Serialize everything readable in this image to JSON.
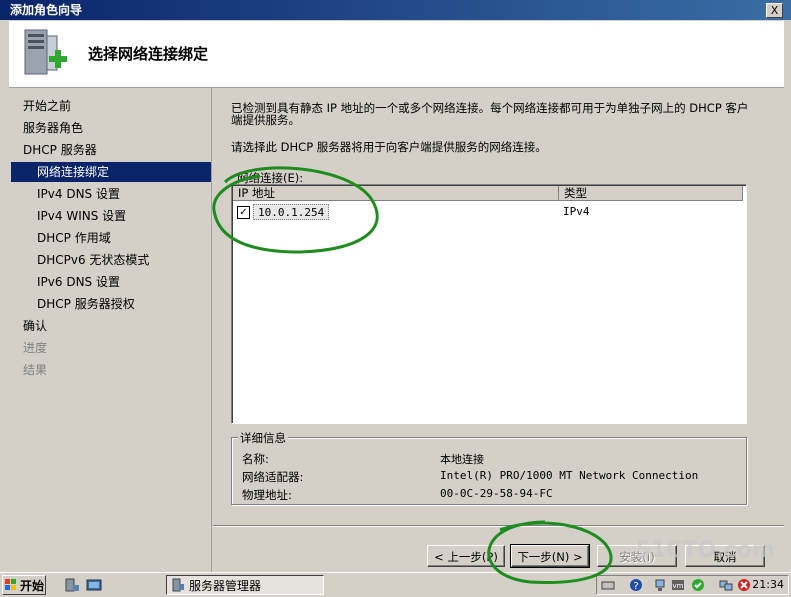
{
  "window": {
    "title": "添加角色向导",
    "close_label": "X"
  },
  "header": {
    "title": "选择网络连接绑定",
    "icon": "server-add-icon"
  },
  "nav": {
    "items": [
      {
        "label": "开始之前",
        "level": 0,
        "state": "normal"
      },
      {
        "label": "服务器角色",
        "level": 0,
        "state": "normal"
      },
      {
        "label": "DHCP 服务器",
        "level": 0,
        "state": "normal"
      },
      {
        "label": "网络连接绑定",
        "level": 1,
        "state": "active"
      },
      {
        "label": "IPv4 DNS 设置",
        "level": 1,
        "state": "normal"
      },
      {
        "label": "IPv4 WINS 设置",
        "level": 1,
        "state": "normal"
      },
      {
        "label": "DHCP 作用域",
        "level": 1,
        "state": "normal"
      },
      {
        "label": "DHCPv6 无状态模式",
        "level": 1,
        "state": "normal"
      },
      {
        "label": "IPv6 DNS 设置",
        "level": 1,
        "state": "normal"
      },
      {
        "label": "DHCP 服务器授权",
        "level": 1,
        "state": "normal"
      },
      {
        "label": "确认",
        "level": 0,
        "state": "normal"
      },
      {
        "label": "进度",
        "level": 0,
        "state": "disabled"
      },
      {
        "label": "结果",
        "level": 0,
        "state": "disabled"
      }
    ]
  },
  "content": {
    "description": "已检测到具有静态 IP 地址的一个或多个网络连接。每个网络连接都可用于为单独子网上的 DHCP 客户端提供服务。",
    "instruction": "请选择此 DHCP 服务器将用于向客户端提供服务的网络连接。",
    "list_label": "网络连接(E):",
    "columns": [
      "IP 地址",
      "类型"
    ],
    "rows": [
      {
        "checked": true,
        "ip": "10.0.1.254",
        "type": "IPv4"
      }
    ],
    "details": {
      "legend": "详细信息",
      "name_label": "名称:",
      "name_value": "本地连接",
      "adapter_label": "网络适配器:",
      "adapter_value": "Intel(R) PRO/1000 MT Network Connection",
      "mac_label": "物理地址:",
      "mac_value": "00-0C-29-58-94-FC"
    }
  },
  "buttons": {
    "prev": "< 上一步(P)",
    "next": "下一步(N) >",
    "install": "安装(I)",
    "cancel": "取消"
  },
  "taskbar": {
    "start": "开始",
    "task_button": "服务器管理器",
    "clock": "21:34"
  },
  "watermark": "51CTO.com",
  "colors": {
    "title_bar": "#0a246a",
    "selection": "#0a246a",
    "annotation": "#1e8c1e"
  }
}
